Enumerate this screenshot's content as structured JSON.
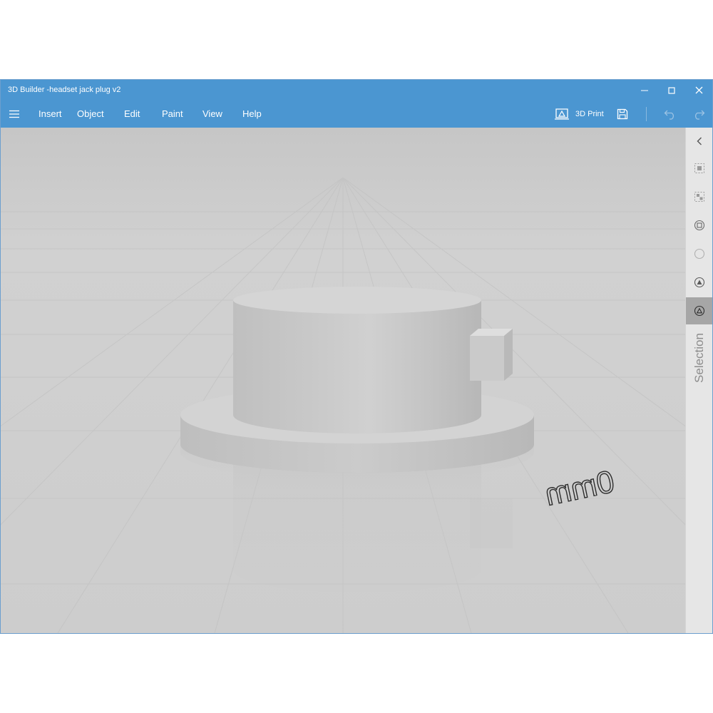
{
  "window": {
    "title": "3D Builder -headset jack plug v2"
  },
  "menu": {
    "items": [
      "Insert",
      "Object",
      "Edit",
      "Paint",
      "View",
      "Help"
    ]
  },
  "toolbar": {
    "print_label": "3D Print",
    "icons": [
      "print-3d-icon",
      "save-icon",
      "undo-icon",
      "redo-icon"
    ]
  },
  "viewport": {
    "ruler_label": "0mm"
  },
  "right_panel": {
    "label": "Selection",
    "icons": [
      "chevron-left-icon",
      "select-group-icon",
      "select-ungroup-icon",
      "select-objects-icon",
      "select-none-icon",
      "select-faces-icon",
      "select-triangles-icon"
    ]
  },
  "colors": {
    "title_bar": "#4b96d1",
    "viewport_bg": "#cfcfcf",
    "panel_bg": "#e6e6e6",
    "selected_tool": "#a6a6a6"
  }
}
